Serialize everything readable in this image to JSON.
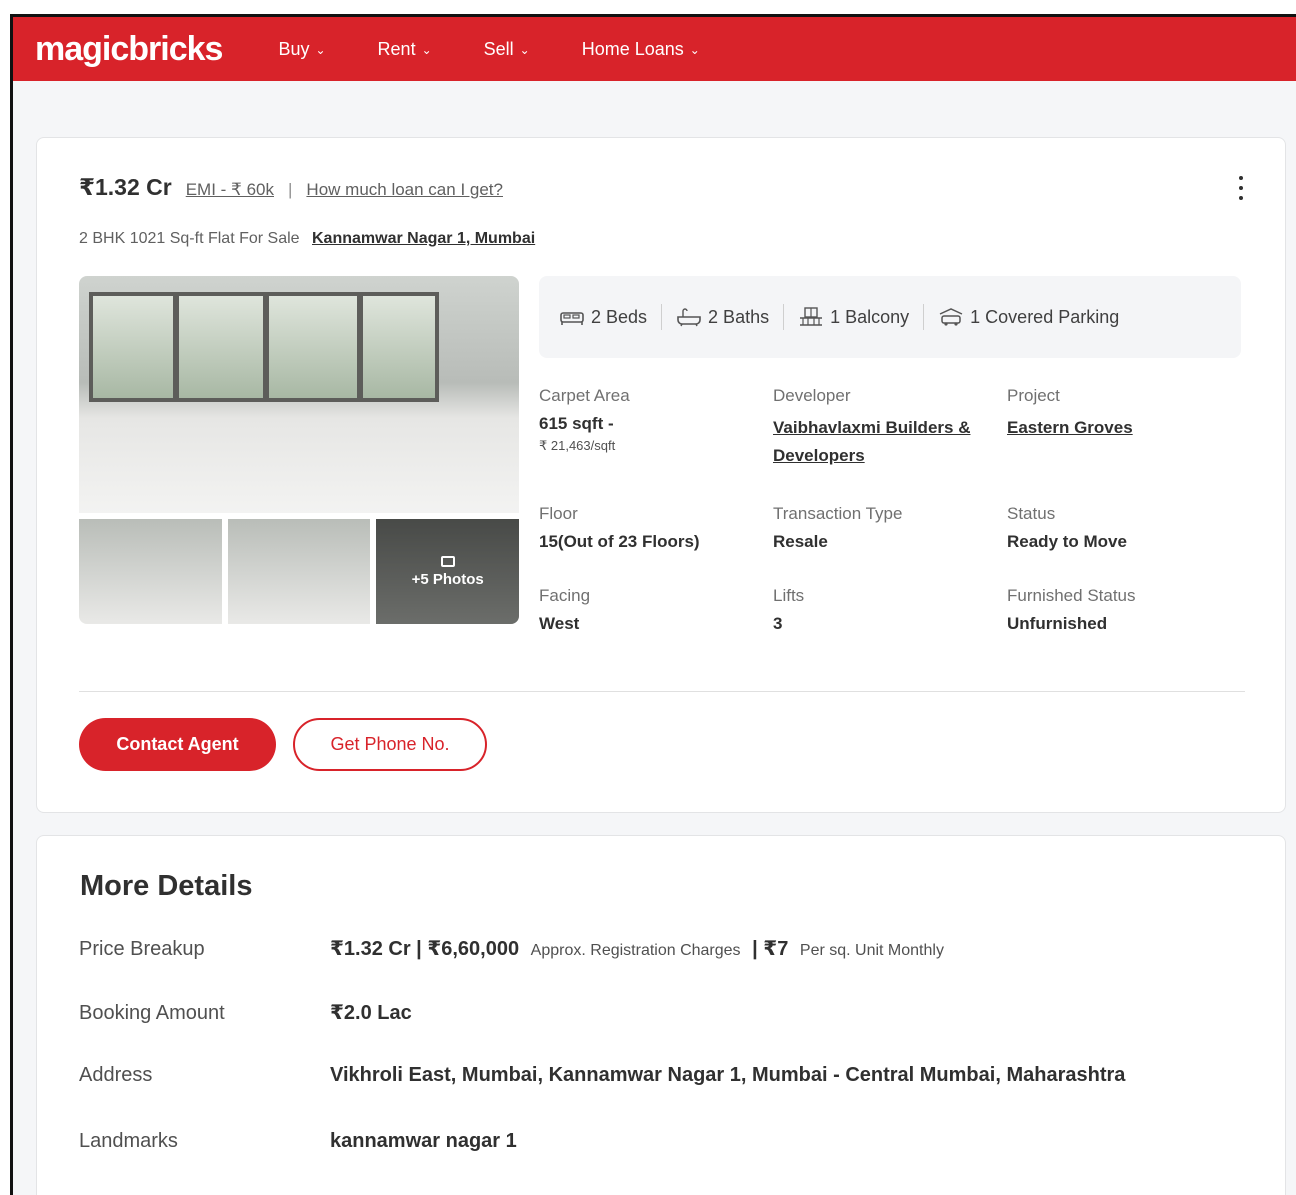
{
  "header": {
    "logo": "magicbricks",
    "nav": [
      "Buy",
      "Rent",
      "Sell",
      "Home Loans"
    ]
  },
  "listing": {
    "price": "₹1.32 Cr",
    "emi": "EMI - ₹ 60k",
    "separator": "|",
    "loan_link": "How much loan can I get?",
    "subtitle": "2 BHK 1021 Sq-ft Flat For Sale",
    "location": "Kannamwar Nagar 1, Mumbai",
    "photos_more": "+5 Photos",
    "amenities": [
      "2 Beds",
      "2 Baths",
      "1 Balcony",
      "1 Covered Parking"
    ],
    "facts": {
      "carpet_area": {
        "label": "Carpet Area",
        "value": "615 sqft -",
        "sub": "₹ 21,463/sqft"
      },
      "developer": {
        "label": "Developer",
        "value": "Vaibhavlaxmi Builders & Developers"
      },
      "project": {
        "label": "Project",
        "value": "Eastern Groves"
      },
      "floor": {
        "label": "Floor",
        "value": "15(Out of 23 Floors)"
      },
      "transaction": {
        "label": "Transaction Type",
        "value": "Resale"
      },
      "status": {
        "label": "Status",
        "value": "Ready to Move"
      },
      "facing": {
        "label": "Facing",
        "value": "West"
      },
      "lifts": {
        "label": "Lifts",
        "value": "3"
      },
      "furnished": {
        "label": "Furnished Status",
        "value": "Unfurnished"
      }
    },
    "contact_button": "Contact Agent",
    "phone_button": "Get Phone No."
  },
  "more_details": {
    "title": "More Details",
    "price_breakup_label": "Price Breakup",
    "price_breakup_value": "₹1.32 Cr | ₹6,60,000",
    "price_breakup_reg": "Approx. Registration Charges",
    "price_breakup_maint": "| ₹7",
    "price_breakup_unit": "Per sq. Unit Monthly",
    "booking_label": "Booking Amount",
    "booking_value": "₹2.0 Lac",
    "address_label": "Address",
    "address_value": "Vikhroli East, Mumbai, Kannamwar Nagar 1, Mumbai - Central Mumbai, Maharashtra",
    "landmarks_label": "Landmarks",
    "landmarks_value": "kannamwar nagar 1"
  },
  "colors": {
    "brand": "#d8232a"
  },
  "icons": [
    "chevron-down-icon",
    "more-vertical-icon",
    "photo-icon",
    "bed-icon",
    "bath-icon",
    "balcony-icon",
    "parking-icon"
  ]
}
